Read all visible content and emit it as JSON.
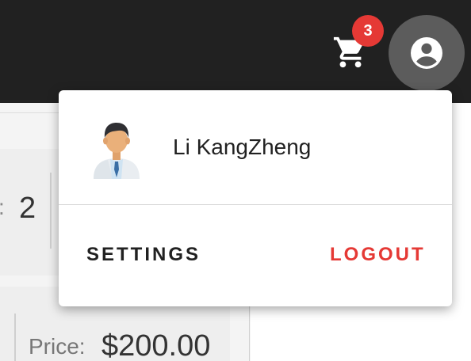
{
  "header": {
    "cart": {
      "icon": "shopping-cart-icon",
      "badge_count": "3",
      "badge_color": "#e53935"
    },
    "account": {
      "icon": "account-circle-icon"
    }
  },
  "background": {
    "quantity_label": ":",
    "quantity_value": "2",
    "price_label": "Price:",
    "price_value": "$200.00"
  },
  "menu": {
    "user_name": "Li KangZheng",
    "avatar": "user-avatar",
    "settings_label": "SETTINGS",
    "logout_label": "LOGOUT",
    "logout_color": "#e53935"
  }
}
